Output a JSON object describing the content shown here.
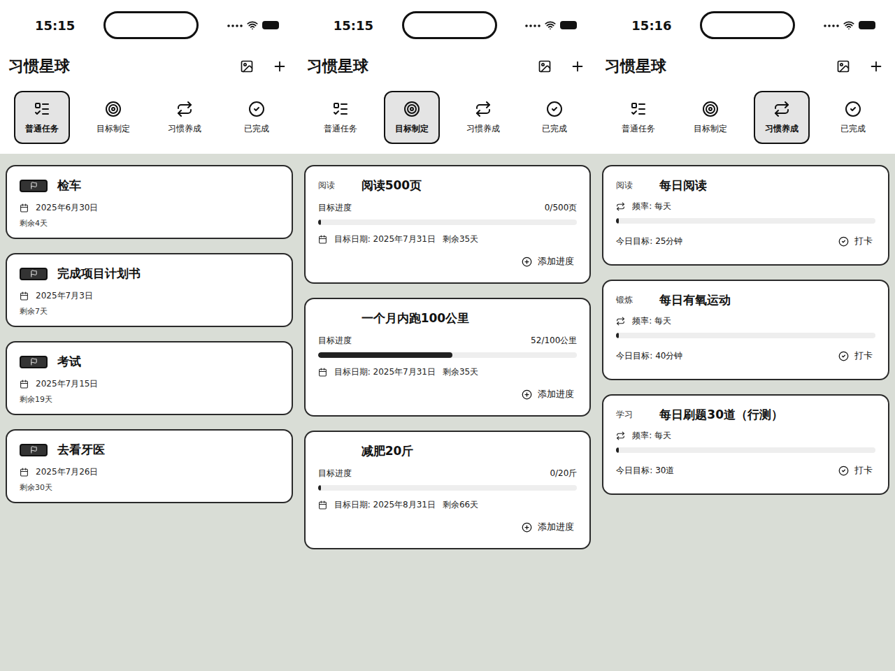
{
  "screens": [
    {
      "status_bar": {
        "time": "15:15"
      },
      "title": "习惯星球",
      "kind": "task",
      "tabs": [
        {
          "label": "普通任务",
          "selected": true
        },
        {
          "label": "目标制定",
          "selected": false
        },
        {
          "label": "习惯养成",
          "selected": false
        },
        {
          "label": "已完成",
          "selected": false
        }
      ],
      "items": [
        {
          "title": "检车",
          "date": "2025年6月30日",
          "remaining": "剩余4天"
        },
        {
          "title": "完成项目计划书",
          "date": "2025年7月3日",
          "remaining": "剩余7天"
        },
        {
          "title": "考试",
          "date": "2025年7月15日",
          "remaining": "剩余19天"
        },
        {
          "title": "去看牙医",
          "date": "2025年7月26日",
          "remaining": "剩余30天"
        }
      ]
    },
    {
      "status_bar": {
        "time": "15:15"
      },
      "title": "习惯星球",
      "kind": "goal",
      "tabs": [
        {
          "label": "普通任务",
          "selected": false
        },
        {
          "label": "目标制定",
          "selected": true
        },
        {
          "label": "习惯养成",
          "selected": false
        },
        {
          "label": "已完成",
          "selected": false
        }
      ],
      "items": [
        {
          "tag": "阅读",
          "title": "阅读500页",
          "progress_label": "目标进度",
          "reading": "0/500页",
          "level": 0,
          "date": "目标日期: 2025年7月31日",
          "remaining": "剩余35天",
          "action": "添加进度"
        },
        {
          "title": "一个月内跑100公里",
          "progress_label": "目标进度",
          "reading": "52/100公里",
          "level": 0.52,
          "date": "目标日期: 2025年7月31日",
          "remaining": "剩余35天",
          "action": "添加进度"
        },
        {
          "title": "减肥20斤",
          "progress_label": "目标进度",
          "reading": "0/20斤",
          "level": 0,
          "date": "目标日期: 2025年8月31日",
          "remaining": "剩余66天",
          "action": "添加进度"
        }
      ]
    },
    {
      "status_bar": {
        "time": "15:16"
      },
      "title": "习惯星球",
      "kind": "habit",
      "tabs": [
        {
          "label": "普通任务",
          "selected": false
        },
        {
          "label": "目标制定",
          "selected": false
        },
        {
          "label": "习惯养成",
          "selected": true
        },
        {
          "label": "已完成",
          "selected": false
        }
      ],
      "items": [
        {
          "tag": "阅读",
          "title": "每日阅读",
          "frequency": "频率: 每天",
          "level": 0,
          "target": "今日目标: 25分钟",
          "action": "打卡"
        },
        {
          "tag": "锻炼",
          "title": "每日有氧运动",
          "frequency": "频率: 每天",
          "level": 0,
          "target": "今日目标: 40分钟",
          "action": "打卡"
        },
        {
          "tag": "学习",
          "title": "每日刷题30道（行测）",
          "frequency": "频率: 每天",
          "level": 0,
          "target": "今日目标: 30道",
          "action": "打卡"
        }
      ]
    }
  ]
}
